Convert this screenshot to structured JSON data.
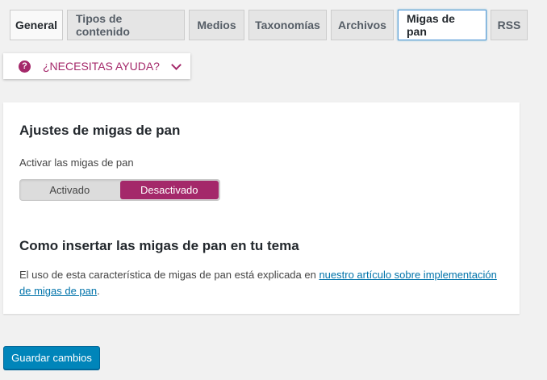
{
  "tabs": [
    {
      "label": "General"
    },
    {
      "label": "Tipos de contenido"
    },
    {
      "label": "Medios"
    },
    {
      "label": "Taxonomías"
    },
    {
      "label": "Archivos"
    },
    {
      "label": "Migas de pan"
    },
    {
      "label": "RSS"
    }
  ],
  "active_tab": "Migas de pan",
  "help": {
    "icon": "question-circle-icon",
    "label": "¿NECESITAS AYUDA?",
    "chevron": "chevron-down-icon"
  },
  "section1": {
    "title": "Ajustes de migas de pan",
    "toggle_label": "Activar las migas de pan",
    "on_label": "Activado",
    "off_label": "Desactivado",
    "selected": "Desactivado"
  },
  "section2": {
    "title": "Como insertar las migas de pan en tu tema",
    "text_before": "El uso de esta característica de migas de pan está explicada en ",
    "link_text": "nuestro artículo sobre implementación de migas de pan",
    "text_after": "."
  },
  "save_label": "Guardar cambios",
  "colors": {
    "accent": "#a4286a",
    "primary": "#0085ba",
    "link": "#0073aa"
  }
}
